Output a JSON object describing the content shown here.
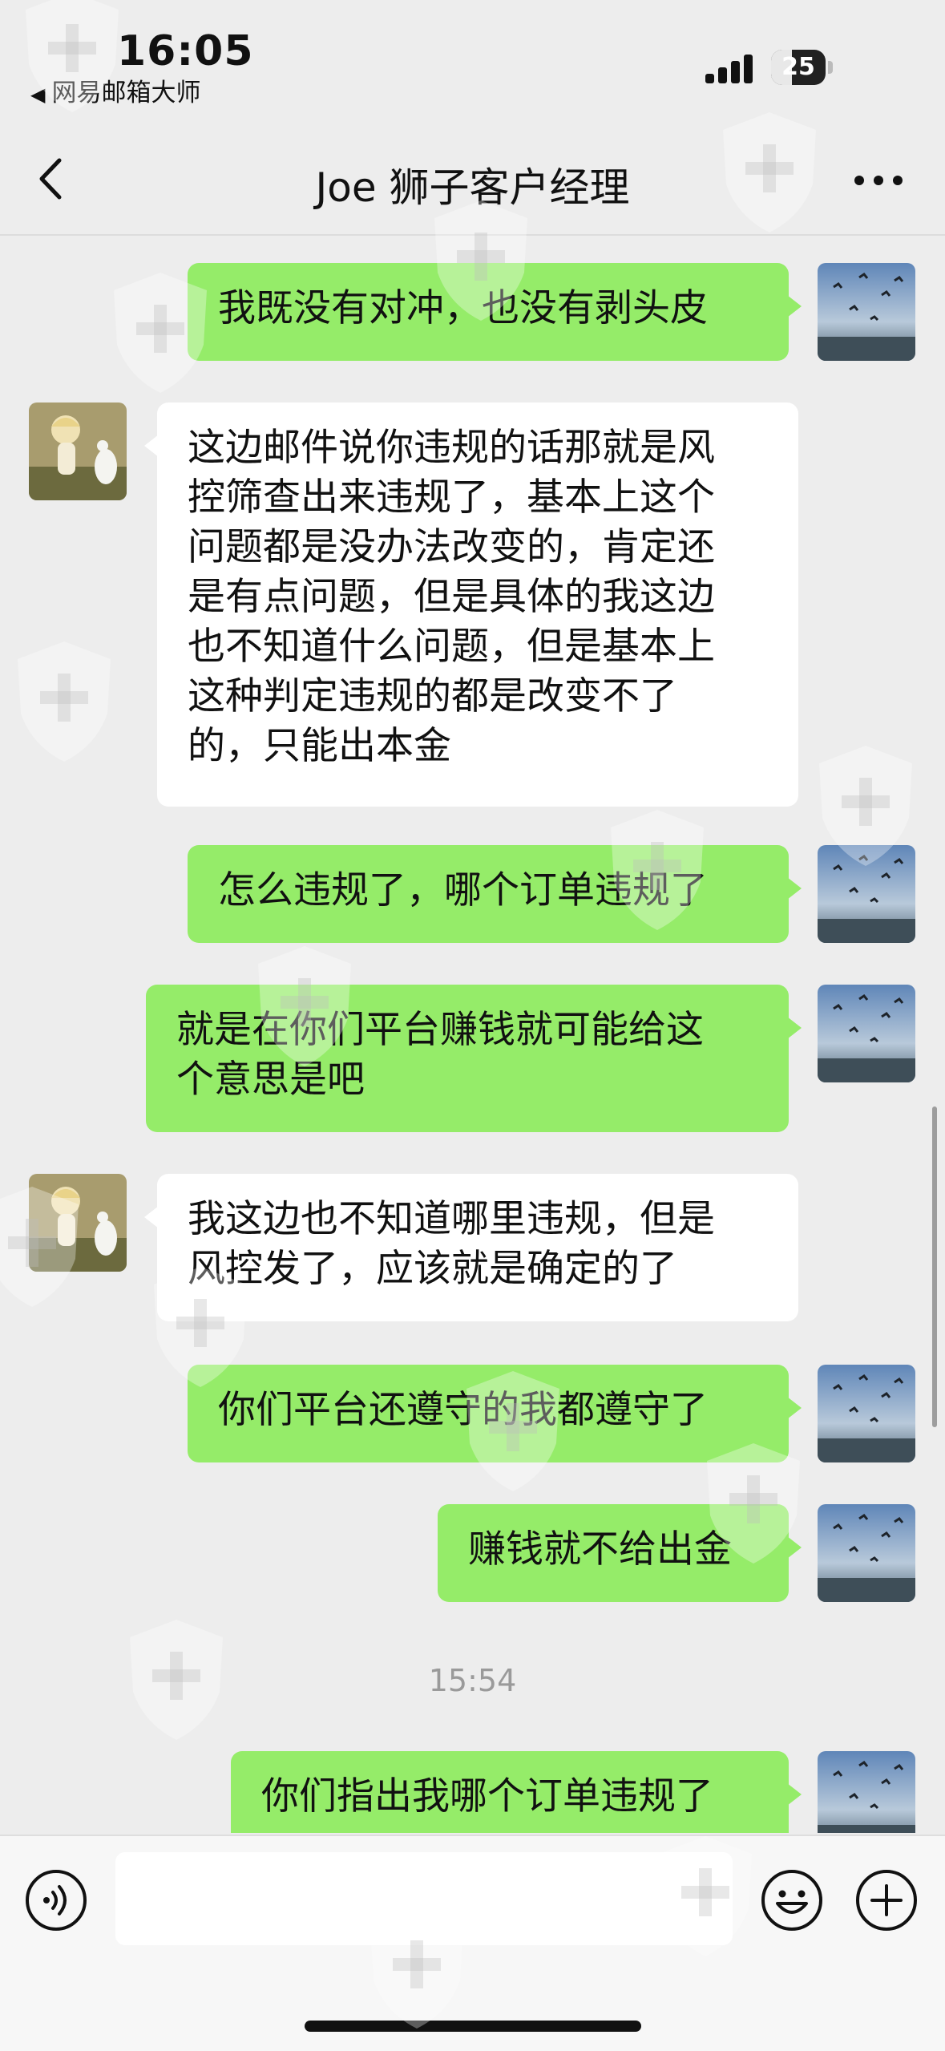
{
  "status_bar": {
    "time": "16:05",
    "back_app": "网易邮箱大师",
    "battery": "25"
  },
  "nav": {
    "title": "Joe 狮子客户经理"
  },
  "messages": [
    {
      "from": "me",
      "text": "我既没有对冲，也没有剥头皮"
    },
    {
      "from": "other",
      "lines": [
        "这边邮件说你违规的话那就是风",
        "控筛查出来违规了，基本上这个",
        "问题都是没办法改变的，肯定还",
        "是有点问题，但是具体的我这边",
        "也不知道什么问题，但是基本上",
        "这种判定违规的都是改变不了",
        "的，只能出本金"
      ]
    },
    {
      "from": "me",
      "text": "怎么违规了，哪个订单违规了"
    },
    {
      "from": "me",
      "lines": [
        "就是在你们平台赚钱就可能给这",
        "个意思是吧"
      ]
    },
    {
      "from": "other",
      "lines": [
        "我这边也不知道哪里违规，但是",
        "风控发了，应该就是确定的了"
      ]
    },
    {
      "from": "me",
      "text": "你们平台还遵守的我都遵守了"
    },
    {
      "from": "me",
      "text": "赚钱就不给出金"
    },
    {
      "from": "me",
      "text": "你们指出我哪个订单违规了"
    }
  ],
  "timestamp": "15:54",
  "colors": {
    "background": "#ededed",
    "bubble_me": "#95ec69",
    "bubble_other": "#ffffff"
  },
  "icons": {
    "back": "chevron-left-icon",
    "more": "more-dots-icon",
    "voice": "voice-icon",
    "emoji": "emoji-icon",
    "plus": "plus-icon"
  }
}
